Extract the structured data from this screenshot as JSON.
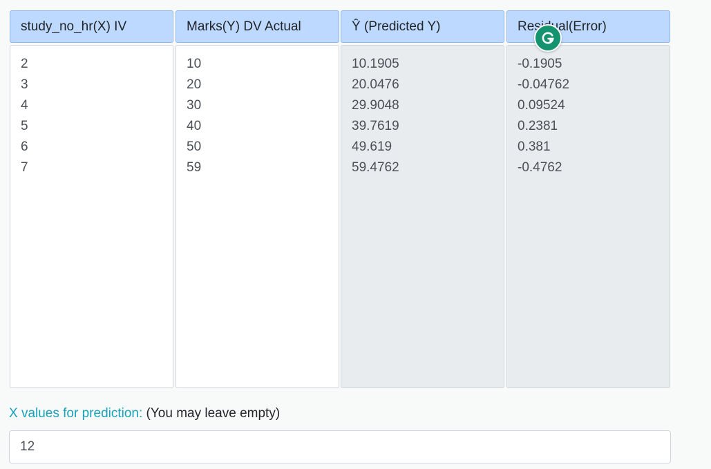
{
  "columns": [
    {
      "header": "study_no_hr(X) IV",
      "values": "2\n3\n4\n5\n6\n7",
      "readonly": false
    },
    {
      "header": "Marks(Y) DV Actual",
      "values": "10\n20\n30\n40\n50\n59",
      "readonly": false
    },
    {
      "header": "Ŷ (Predicted Y)",
      "values": "10.1905\n20.0476\n29.9048\n39.7619\n49.619\n59.4762",
      "readonly": true
    },
    {
      "header": "Residual(Error)",
      "values": "-0.1905\n-0.04762\n0.09524\n0.2381\n0.381\n-0.4762",
      "readonly": true
    }
  ],
  "prediction": {
    "label": "X values for prediction:",
    "hint": "(You may leave empty)",
    "value": "12"
  },
  "colors": {
    "header_bg": "#bdd9ff",
    "readonly_bg": "#e9ecef",
    "accent": "#17a2b8",
    "grammarly": "#15936f"
  },
  "icons": {
    "grammarly": "grammarly-g-icon"
  }
}
